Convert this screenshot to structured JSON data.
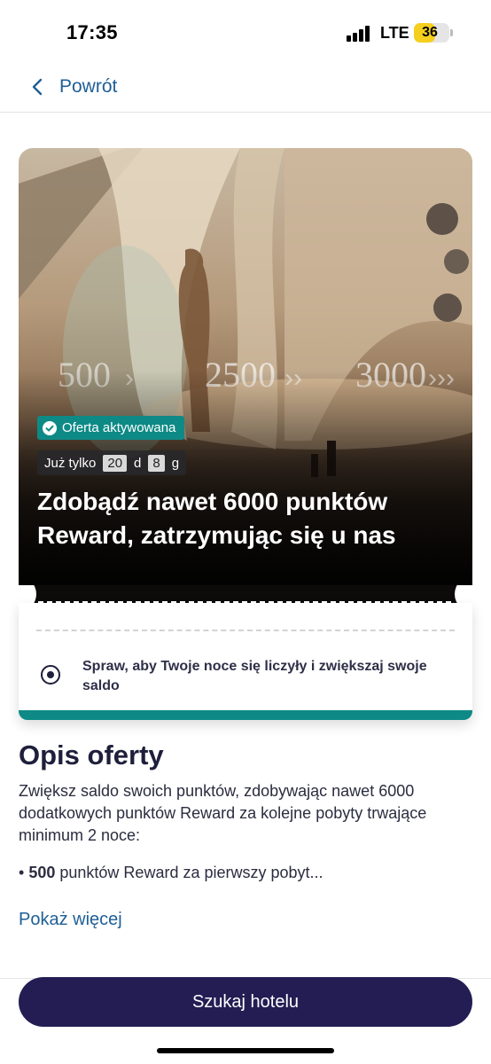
{
  "status_bar": {
    "time": "17:35",
    "network": "LTE",
    "battery": "36",
    "battery_level": 0.36
  },
  "nav": {
    "back_label": "Powrót",
    "back_icon": "chevron-left-icon"
  },
  "hero": {
    "image_numbers": [
      "500",
      "2500",
      "3000"
    ],
    "badge_label": "Oferta aktywowana",
    "badge_icon": "check-circle-icon",
    "countdown_prefix": "Już tylko",
    "countdown_days": "20",
    "countdown_days_unit": "d",
    "countdown_hours": "8",
    "countdown_hours_unit": "g",
    "title": "Zdobądź nawet 6000 punktów Reward, zatrzymując się u nas"
  },
  "ticket": {
    "text": "Spraw, aby Twoje noce się liczyły i zwiększaj swoje saldo"
  },
  "description": {
    "title": "Opis oferty",
    "body": "Zwiększ saldo swoich punktów, zdobywając nawet 6000 dodatkowych punktów Reward za kolejne pobyty trwające minimum 2 noce:",
    "bullet_marker": "•",
    "bullet_bold": "500",
    "bullet_rest": "punktów Reward za pierwszy pobyt...",
    "show_more": "Pokaż więcej"
  },
  "cta": {
    "label": "Szukaj hotelu"
  },
  "colors": {
    "accent_blue": "#1f5f96",
    "teal": "#0e8a86",
    "navy": "#231d54"
  }
}
